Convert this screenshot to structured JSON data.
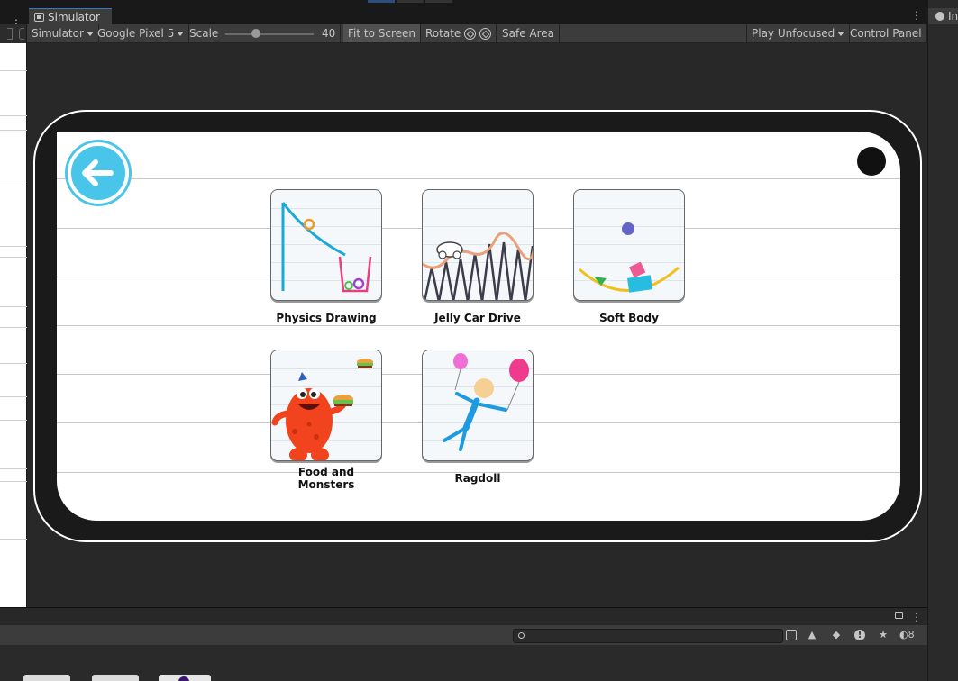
{
  "window": {
    "tab_title": "Simulator"
  },
  "toolbar": {
    "view_mode": "Simulator",
    "device": "Google Pixel 5",
    "scale_label": "Scale",
    "scale_value": "40",
    "scale_fraction": 0.35,
    "fit_to_screen": "Fit to Screen",
    "rotate": "Rotate",
    "safe_area": "Safe Area",
    "play_focus": "Play Unfocused",
    "control_panel": "Control Panel"
  },
  "game": {
    "cards": [
      {
        "label": "Physics Drawing",
        "icon": "physics-drawing-thumbnail"
      },
      {
        "label": "Jelly Car Drive",
        "icon": "jelly-car-thumbnail"
      },
      {
        "label": "Soft Body",
        "icon": "soft-body-thumbnail"
      },
      {
        "label": "Food and Monsters",
        "icon": "food-monsters-thumbnail"
      },
      {
        "label": "Ragdoll",
        "icon": "ragdoll-thumbnail"
      }
    ],
    "back_button_icon": "back-arrow-icon"
  },
  "colors": {
    "accent_blue": "#4ac5ea",
    "editor_bg": "#282828",
    "toolbar_bg": "#3c3c3c"
  },
  "project_bar": {
    "search_placeholder": "",
    "hidden_count": "8"
  },
  "right_panel": {
    "tab_title": "In"
  }
}
